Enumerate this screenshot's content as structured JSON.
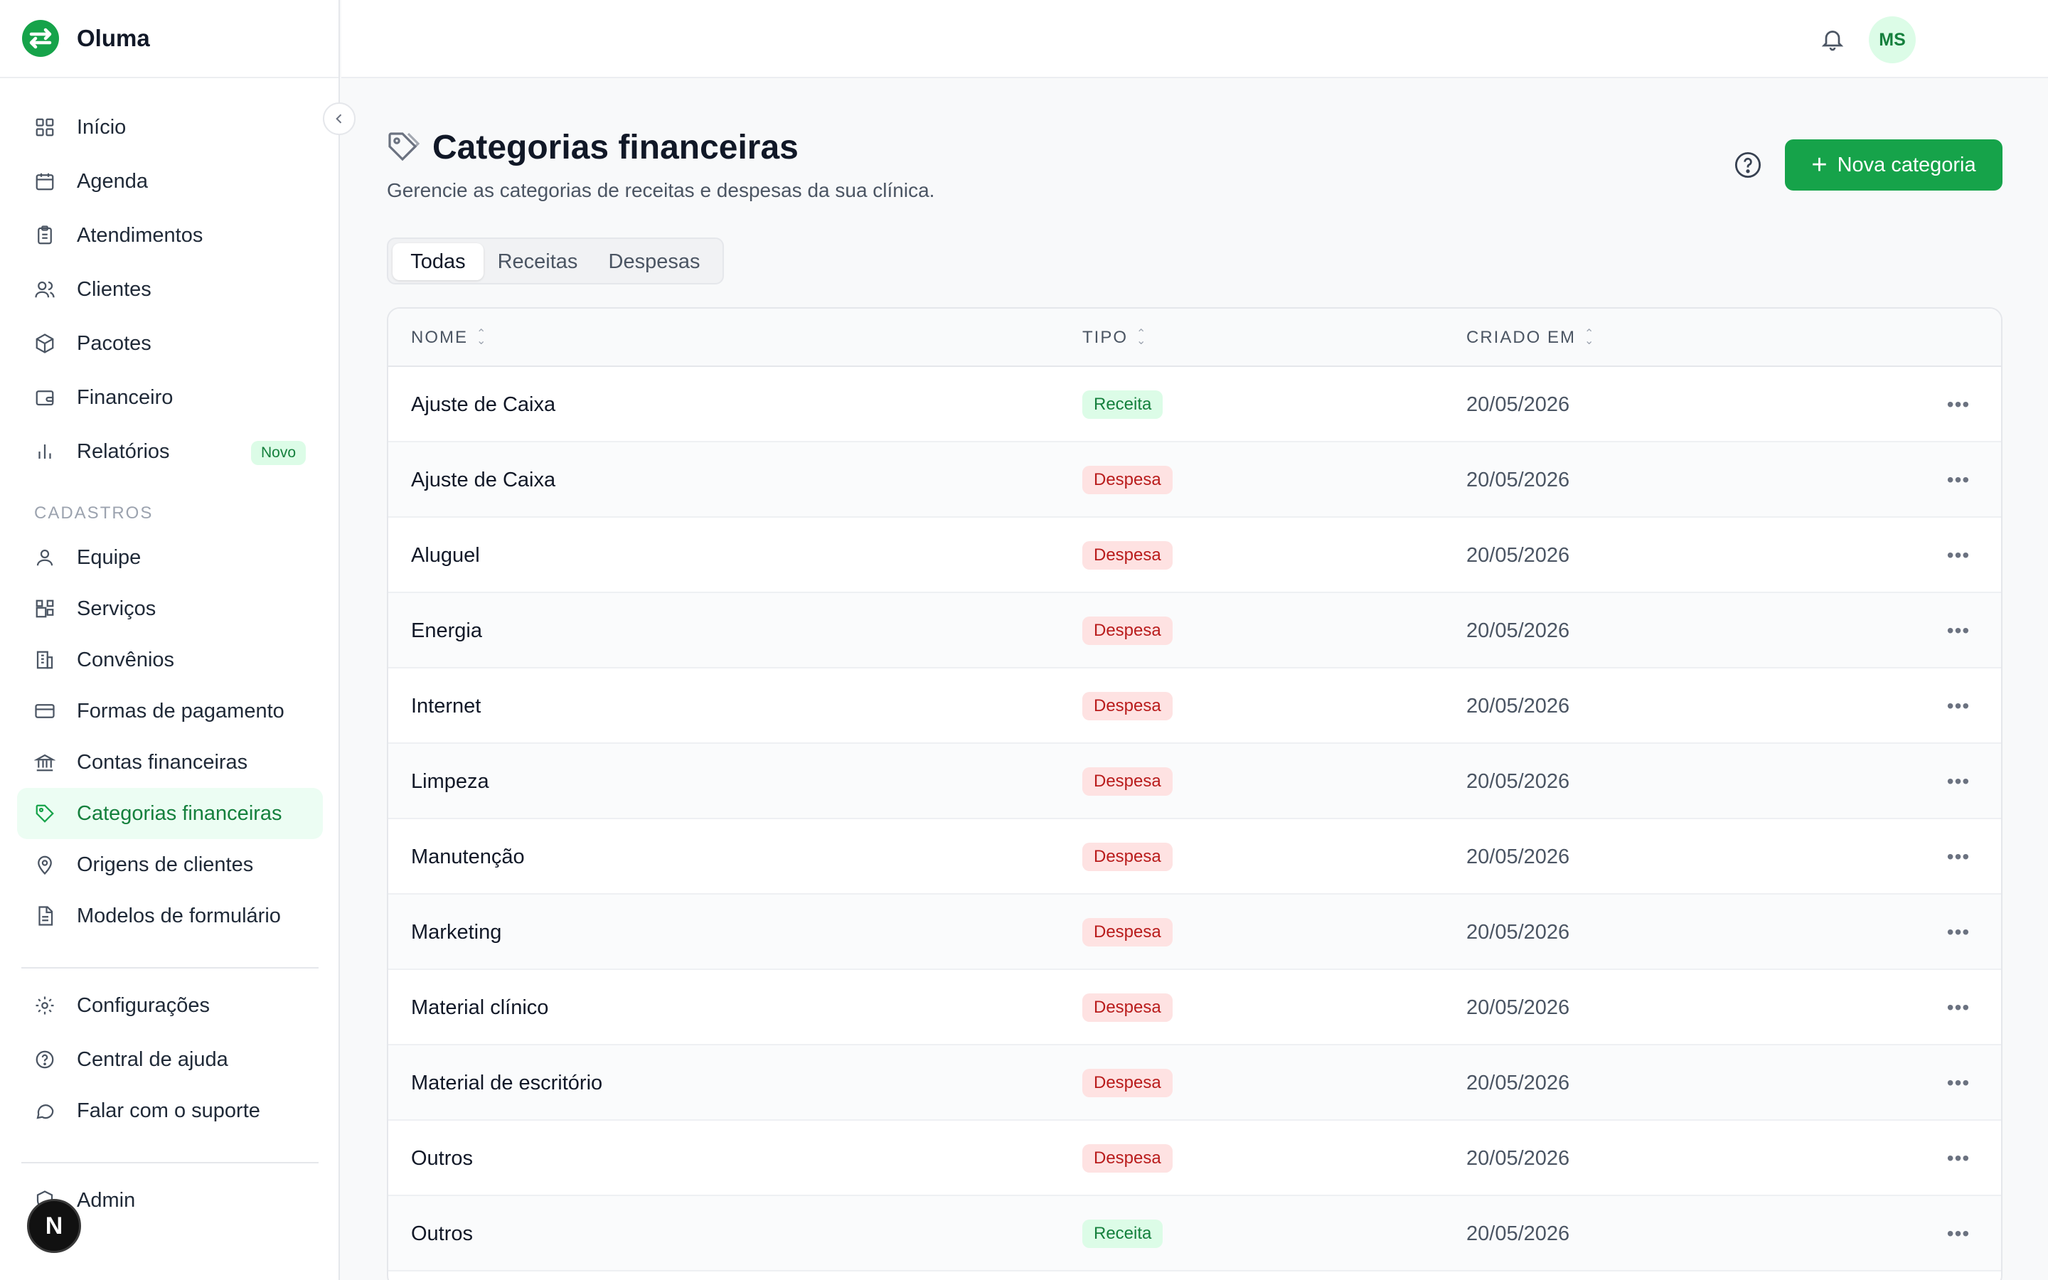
{
  "app": {
    "name": "Oluma"
  },
  "sidebar": {
    "main_items": [
      {
        "label": "Início",
        "icon": "dashboard-icon"
      },
      {
        "label": "Agenda",
        "icon": "calendar-icon"
      },
      {
        "label": "Atendimentos",
        "icon": "clipboard-icon"
      },
      {
        "label": "Clientes",
        "icon": "users-icon"
      },
      {
        "label": "Pacotes",
        "icon": "package-icon"
      },
      {
        "label": "Financeiro",
        "icon": "wallet-icon"
      },
      {
        "label": "Relatórios",
        "icon": "bar-chart-icon",
        "badge": "Novo"
      }
    ],
    "section_label": "CADASTROS",
    "register_items": [
      {
        "label": "Equipe",
        "icon": "user-icon"
      },
      {
        "label": "Serviços",
        "icon": "services-icon"
      },
      {
        "label": "Convênios",
        "icon": "building-icon"
      },
      {
        "label": "Formas de pagamento",
        "icon": "credit-card-icon"
      },
      {
        "label": "Contas financeiras",
        "icon": "bank-icon"
      },
      {
        "label": "Categorias financeiras",
        "icon": "tag-icon",
        "active": true
      },
      {
        "label": "Origens de clientes",
        "icon": "map-pin-icon"
      },
      {
        "label": "Modelos de formulário",
        "icon": "file-text-icon"
      }
    ],
    "footer_items": [
      {
        "label": "Configurações",
        "icon": "gear-icon"
      },
      {
        "label": "Central de ajuda",
        "icon": "help-circle-icon"
      },
      {
        "label": "Falar com o suporte",
        "icon": "message-circle-icon"
      }
    ],
    "admin_item": {
      "label": "Admin",
      "icon": "shield-icon"
    },
    "fab_label": "N"
  },
  "topbar": {
    "avatar_initials": "MS"
  },
  "header": {
    "title": "Categorias financeiras",
    "subtitle": "Gerencie as categorias de receitas e despesas da sua clínica.",
    "new_button_label": "Nova categoria"
  },
  "tabs": [
    {
      "label": "Todas",
      "active": true
    },
    {
      "label": "Receitas"
    },
    {
      "label": "Despesas"
    }
  ],
  "table": {
    "columns": [
      "NOME",
      "TIPO",
      "CRIADO EM"
    ],
    "rows": [
      {
        "name": "Ajuste de Caixa",
        "type": "Receita",
        "created": "20/05/2026"
      },
      {
        "name": "Ajuste de Caixa",
        "type": "Despesa",
        "created": "20/05/2026"
      },
      {
        "name": "Aluguel",
        "type": "Despesa",
        "created": "20/05/2026"
      },
      {
        "name": "Energia",
        "type": "Despesa",
        "created": "20/05/2026"
      },
      {
        "name": "Internet",
        "type": "Despesa",
        "created": "20/05/2026"
      },
      {
        "name": "Limpeza",
        "type": "Despesa",
        "created": "20/05/2026"
      },
      {
        "name": "Manutenção",
        "type": "Despesa",
        "created": "20/05/2026"
      },
      {
        "name": "Marketing",
        "type": "Despesa",
        "created": "20/05/2026"
      },
      {
        "name": "Material clínico",
        "type": "Despesa",
        "created": "20/05/2026"
      },
      {
        "name": "Material de escritório",
        "type": "Despesa",
        "created": "20/05/2026"
      },
      {
        "name": "Outros",
        "type": "Despesa",
        "created": "20/05/2026"
      },
      {
        "name": "Outros",
        "type": "Receita",
        "created": "20/05/2026"
      }
    ]
  },
  "colors": {
    "brand_green": "#16a34a",
    "receita_bg": "#dcfce7",
    "receita_text": "#15803d",
    "despesa_bg": "#fee2e2",
    "despesa_text": "#b91c1c"
  }
}
